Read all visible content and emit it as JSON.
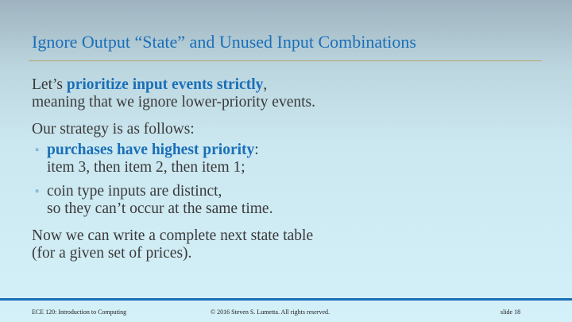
{
  "slide": {
    "title": "Ignore Output “State” and Unused Input Combinations"
  },
  "content": {
    "p1": {
      "pre": "Let’s ",
      "em": "prioritize input events strictly",
      "post": ",",
      "line2": "meaning that we ignore lower-priority events."
    },
    "p2": "Our strategy is as follows:",
    "bullets": [
      {
        "marker": "◦",
        "em": "purchases have highest priority",
        "post": ":",
        "line2": "item 3, then item 2, then item 1;"
      },
      {
        "marker": "◦",
        "line1": "coin type inputs are distinct,",
        "line2": "so they can’t occur at the same time."
      }
    ],
    "p3": {
      "line1": "Now we can write a complete next state table",
      "line2": "(for a given set of prices)."
    }
  },
  "footer": {
    "course": "ECE 120: Introduction to Computing",
    "copyright": "© 2016 Steven S. Lumetta.  All rights reserved.",
    "slide": "slide 18"
  },
  "colors": {
    "accent": "#1a6fb8",
    "rule": "#b7a86a",
    "text": "#3a3a3a"
  }
}
